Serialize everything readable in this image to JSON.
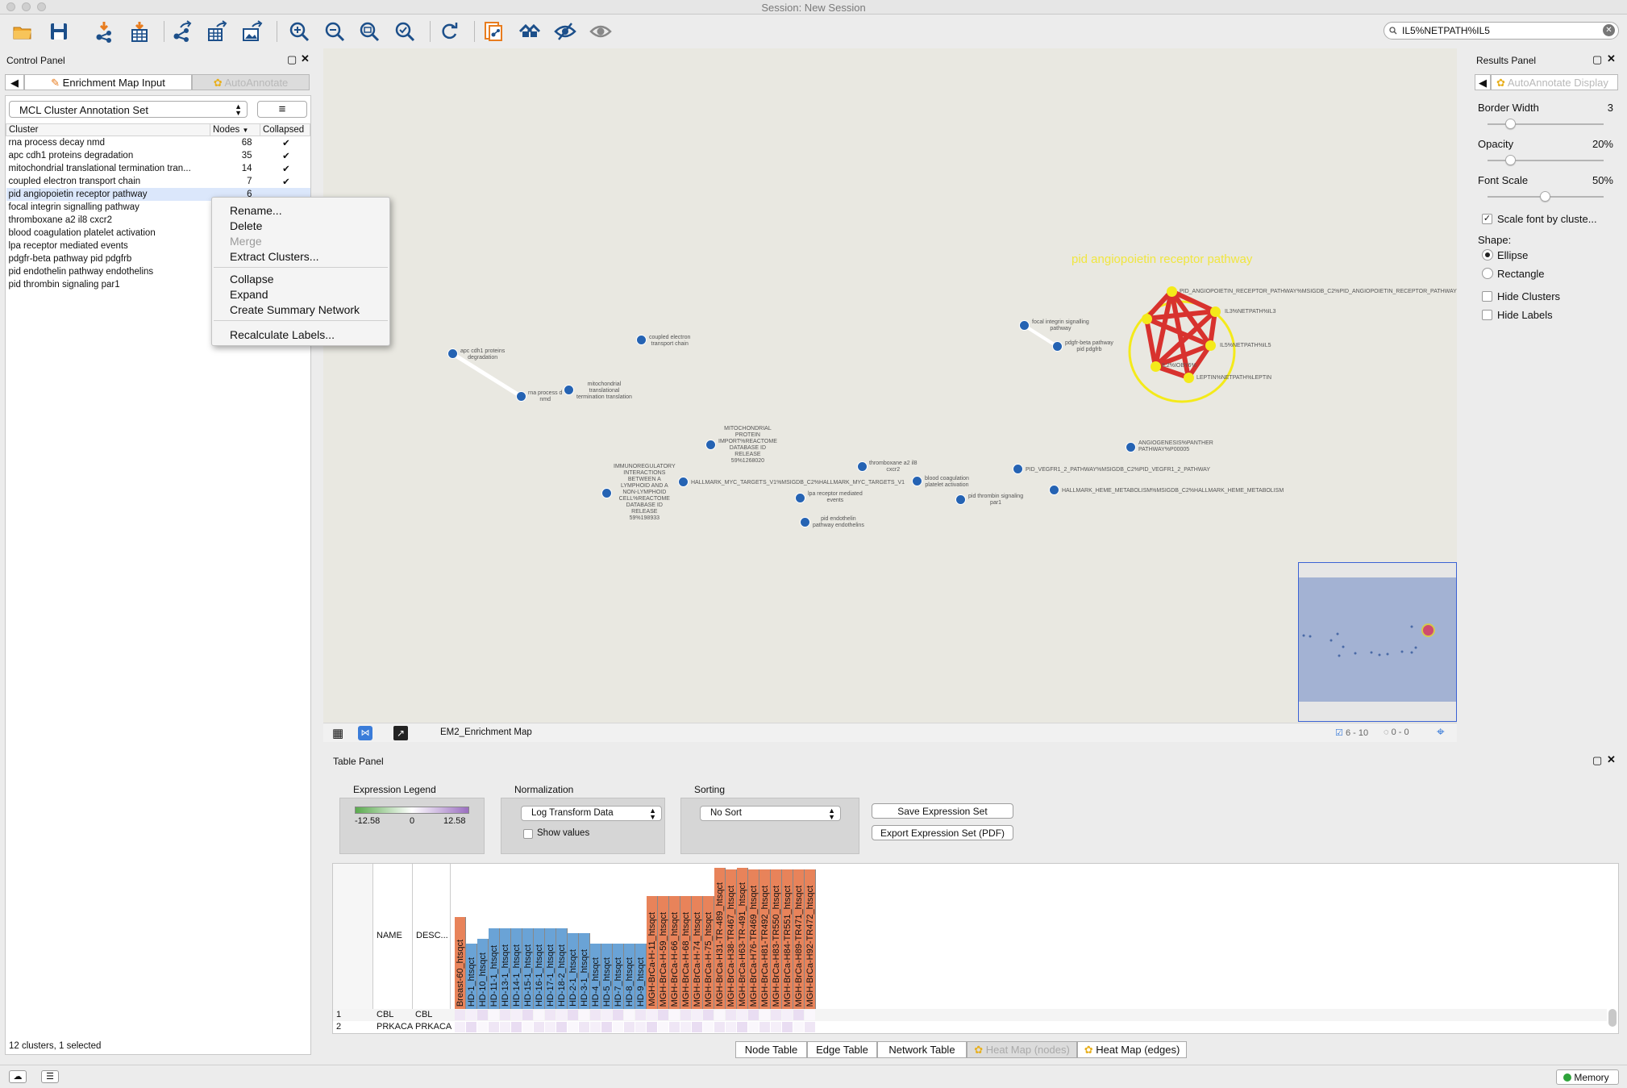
{
  "window": {
    "title": "Session: New Session"
  },
  "toolbar": {
    "icons": [
      "open-folder-icon",
      "save-icon",
      "import-network-icon",
      "import-table-icon",
      "share-network-icon",
      "export-table-icon",
      "export-image-icon",
      "zoom-in-icon",
      "zoom-out-icon",
      "zoom-fit-icon",
      "zoom-selected-icon",
      "refresh-icon",
      "new-network-icon",
      "home-icon",
      "hide-icon",
      "show-icon"
    ],
    "search_value": "IL5%NETPATH%IL5"
  },
  "control_panel": {
    "title": "Control Panel",
    "tabs": [
      "Enrichment Map Input",
      "AutoAnnotate"
    ],
    "annotation_set": "MCL Cluster Annotation Set",
    "columns": [
      "Cluster",
      "Nodes",
      "Collapsed"
    ],
    "rows": [
      {
        "name": "rna process decay nmd",
        "nodes": "68",
        "collapsed": "✔"
      },
      {
        "name": "apc cdh1 proteins degradation",
        "nodes": "35",
        "collapsed": "✔"
      },
      {
        "name": "mitochondrial translational termination tran...",
        "nodes": "14",
        "collapsed": "✔"
      },
      {
        "name": "coupled electron transport chain",
        "nodes": "7",
        "collapsed": "✔"
      },
      {
        "name": "pid angiopoietin receptor pathway",
        "nodes": "6",
        "collapsed": ""
      },
      {
        "name": "focal integrin signalling pathway",
        "nodes": "",
        "collapsed": ""
      },
      {
        "name": "thromboxane a2 il8 cxcr2",
        "nodes": "",
        "collapsed": ""
      },
      {
        "name": "blood coagulation platelet activation",
        "nodes": "",
        "collapsed": ""
      },
      {
        "name": "lpa receptor mediated events",
        "nodes": "",
        "collapsed": ""
      },
      {
        "name": "pdgfr-beta pathway pid pdgfrb",
        "nodes": "",
        "collapsed": ""
      },
      {
        "name": "pid endothelin pathway endothelins",
        "nodes": "",
        "collapsed": ""
      },
      {
        "name": "pid thrombin signaling par1",
        "nodes": "",
        "collapsed": ""
      }
    ],
    "status": "12 clusters, 1 selected"
  },
  "context_menu": {
    "items": [
      "Rename...",
      "Delete",
      "Merge",
      "Extract Clusters...",
      "Collapse",
      "Expand",
      "Create Summary Network",
      "Recalculate Labels..."
    ]
  },
  "network": {
    "cluster_label": "pid angiopoietin receptor pathway",
    "labels": {
      "apc": "apc cdh1 proteins\ndegradation",
      "rna": "rna process d\nnmd",
      "mito": "mitochondrial\ntranslational\ntermination translation",
      "coupled": "coupled electron\ntransport chain",
      "focal": "focal integrin signalling\npathway",
      "pdgfb": "pdgfr-beta pathway\npid pdgfrb",
      "ang_recep": "PID_ANGIOPOIETIN_RECEPTOR_PATHWAY%MSIGDB_C2%PID_ANGIOPOIETIN_RECEPTOR_PATHWAY",
      "il3": "IL3%NETPATH%IL3",
      "il5": "IL5%NETPATH%IL5",
      "leptin": "LEPTIN%NETPATH%LEPTIN",
      "ikkb": "IL2%IOBY6%",
      "mito_protein": "MITOCHONDRIAL\nPROTEIN\nIMPORT%REACTOME\nDATABASE ID\nRELEASE\n59%1268020",
      "immuno": "IMMUNOREGULATORY\nINTERACTIONS\nBETWEEN A\nLYMPHOID AND A\nNON-LYMPHOID\nCELL%REACTOME\nDATABASE ID\nRELEASE\n59%198933",
      "myc": "HALLMARK_MYC_TARGETS_V1%MSIGDB_C2%HALLMARK_MYC_TARGETS_V1",
      "lpa": "lpa receptor mediated\nevents",
      "endothelin": "pid endothelin\npathway endothelins",
      "thromboxane": "thromboxane a2 il8\ncxcr2",
      "blood": "blood coagulation\nplatelet activation",
      "thrombin": "pid thrombin signaling\npar1",
      "vegfr": "PID_VEGFR1_2_PATHWAY%MSIGDB_C2%PID_VEGFR1_2_PATHWAY",
      "heme": "HALLMARK_HEME_METABOLISM%MSIGDB_C2%HALLMARK_HEME_METABOLISM",
      "angio": "ANGIOGENESIS%PANTHER\nPATHWAY%P00005"
    },
    "view_name": "EM2_Enrichment Map",
    "selected_nodes": "6 - 10",
    "hidden_count": "0 - 0"
  },
  "results_panel": {
    "title": "Results Panel",
    "tab": "AutoAnnotate Display",
    "border_width_label": "Border Width",
    "border_width_value": "3",
    "border_width_fraction": 0.2,
    "opacity_label": "Opacity",
    "opacity_value": "20%",
    "opacity_fraction": 0.2,
    "font_scale_label": "Font Scale",
    "font_scale_value": "50%",
    "font_scale_fraction": 0.5,
    "scale_font_label": "Scale font by cluste...",
    "shape_label": "Shape:",
    "shapes": [
      "Ellipse",
      "Rectangle"
    ],
    "selected_shape": "Ellipse",
    "hide_clusters": "Hide Clusters",
    "hide_labels": "Hide Labels"
  },
  "table_panel": {
    "title": "Table Panel",
    "legend_title": "Expression Legend",
    "legend_min": "-12.58",
    "legend_mid": "0",
    "legend_max": "12.58",
    "normalization_title": "Normalization",
    "normalization_value": "Log Transform Data",
    "show_values": "Show values",
    "sorting_title": "Sorting",
    "sorting_value": "No Sort",
    "save_btn": "Save Expression Set",
    "export_btn": "Export Expression Set (PDF)",
    "name_col": "NAME",
    "desc_col": "DESC...",
    "columns_orange": [
      "Breast-60_htsqct"
    ],
    "columns_blue": [
      "HD-1_htsqct",
      "HD-10_htsqct",
      "HD-11-1_htsqct",
      "HD-13-1_htsqct",
      "HD-14-1_htsqct",
      "HD-15-1_htsqct",
      "HD-16-1_htsqct",
      "HD-17-1_htsqct",
      "HD-18-2_htsqct",
      "HD-2-1_htsqct",
      "HD-3-1_htsqct",
      "HD-4_htsqct",
      "HD-5_htsqct",
      "HD-7_htsqct",
      "HD-8_htsqct",
      "HD-9_htsqct"
    ],
    "columns_red": [
      "MGH-BrCa-H-11_htsqct",
      "MGH-BrCa-H-59_htsqct",
      "MGH-BrCa-H-66_htsqct",
      "MGH-BrCa-H-68_htsqct",
      "MGH-BrCa-H-74_htsqct",
      "MGH-BrCa-H-75_htsqct",
      "MGH-BrCa-H31-TR-489_htsqct",
      "MGH-BrCa-H38-TR467_htsqct",
      "MGH-BrCa-H63-TR-491_htsqct",
      "MGH-BrCa-H76-TR469_htsqct",
      "MGH-BrCa-H81-TR492_htsqct",
      "MGH-BrCa-H83-TR550_htsqct",
      "MGH-BrCa-H84-TR551_htsqct",
      "MGH-BrCa-H89-TR471_htsqct",
      "MGH-BrCa-H92-TR472_htsqct"
    ],
    "rows": [
      {
        "num": "1",
        "name": "CBL",
        "desc": "CBL"
      },
      {
        "num": "2",
        "name": "PRKACA",
        "desc": "PRKACA"
      }
    ],
    "bottom_tabs": [
      "Node Table",
      "Edge Table",
      "Network Table",
      "Heat Map (nodes)",
      "Heat Map (edges)"
    ]
  },
  "status": {
    "memory": "Memory"
  },
  "colors": {
    "node": "#2563b3",
    "selected_node": "#f4ea1a",
    "edge_selected": "#d8322e",
    "orange_header": "#e8835a",
    "blue_header": "#6aa3d6"
  }
}
